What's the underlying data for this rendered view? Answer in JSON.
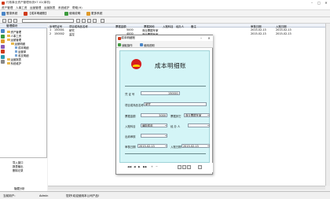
{
  "window": {
    "title": "行政事业资产管理系统V7.02(单机)",
    "controls": [
      "–",
      "□",
      "✕"
    ]
  },
  "menu": [
    "资产管理",
    "人事工资",
    "运营管理",
    "运营报表",
    "系统维护",
    "帮助(H)"
  ],
  "toolbar": {
    "login_label": "登录系统",
    "voucher_label": "【成本明细账】",
    "usage_label": "使用说明",
    "more_label": "更多系统"
  },
  "left_panel": {
    "header": "管理模块",
    "tree": [
      {
        "label": "资产管理",
        "level": 0
      },
      {
        "label": "人事工资",
        "level": 0
      },
      {
        "label": "运营管理",
        "level": 0
      },
      {
        "label": "运营明细",
        "level": 1
      },
      {
        "label": "成本明细",
        "level": 2
      },
      {
        "label": "运营单",
        "level": 2
      },
      {
        "label": "收支明细",
        "level": 2
      },
      {
        "label": "运营报表",
        "level": 0
      },
      {
        "label": "系统维护",
        "level": 0
      }
    ],
    "bottom": [
      "导入窗口",
      "报表输出",
      "删除记录"
    ],
    "footer": "隐藏分析"
  },
  "grid": {
    "columns": [
      "序号",
      "凭证号",
      "项目或商品名称",
      "票据金额",
      "票据其他",
      "入账科目",
      "经办人",
      "备注",
      "审核日期",
      "入账日期"
    ],
    "rows": [
      [
        "1",
        "150001",
        "研究",
        "5000",
        "商业票据专家",
        "",
        "",
        "",
        "2015-02-13",
        "2015-02-13"
      ],
      [
        "2",
        "150002",
        "监控",
        "4000",
        "商业票据专家",
        "",
        "",
        "",
        "2015-02-13",
        "2015-02-13"
      ]
    ]
  },
  "statusbar": {
    "user_label": "当前用户:",
    "user": "Admin",
    "message": "您好!欢迎使用本公司产品!"
  },
  "dialog": {
    "title": "成本明细账",
    "tabs": [
      "读取操作",
      "使用说明"
    ],
    "voucher_title": "成本明细账",
    "fields": {
      "voucher_no_label": "凭 证 号",
      "voucher_no": "150001",
      "item_label": "项目或商品名称",
      "item": "研究",
      "amount_label": "票据金额",
      "amount": "5000",
      "bill_other_label": "票据其它",
      "bill_other": "商业票据专家",
      "account_label": "入账科目",
      "account": "编制费用",
      "handler_label": "经 办 人",
      "handler": "",
      "remark_label": "出纳审核",
      "remark": "",
      "audit_date_label": "审核日期",
      "audit_date": "2015-02-13",
      "entry_date_label": "入账日期",
      "entry_date": "2015-02-13"
    }
  },
  "colors": {
    "accent": "#d03a1a",
    "voucher_bg": "#d4f5f7",
    "logo_red": "#d61e1e",
    "logo_yellow": "#ffd200",
    "folder": "#e8b84a"
  }
}
